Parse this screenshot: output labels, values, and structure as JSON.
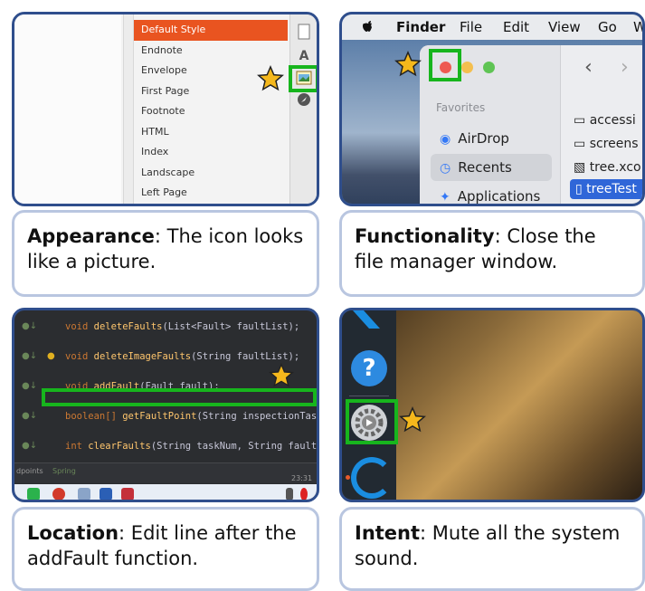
{
  "panel1": {
    "styles": [
      "Default Style",
      "Endnote",
      "Envelope",
      "First Page",
      "Footnote",
      "HTML",
      "Index",
      "Landscape",
      "Left Page"
    ],
    "caption_key": "Appearance",
    "caption_text": ": The icon looks like a picture."
  },
  "panel2": {
    "menu": {
      "apple": "",
      "finder": "Finder",
      "file": "File",
      "edit": "Edit",
      "view": "View",
      "go": "Go",
      "w": "W"
    },
    "favorites_label": "Favorites",
    "sidebar": [
      "AirDrop",
      "Recents",
      "Applications"
    ],
    "files": [
      "accessi",
      "screens",
      "tree.xco",
      "treeTest"
    ],
    "caption_key": "Functionality",
    "caption_text": ": Close the file manager window."
  },
  "panel3": {
    "lines": [
      {
        "kw": "void",
        "fn": "deleteFaults",
        "rest": "(List<Fault> faultList);"
      },
      {
        "kw": "void",
        "fn": "deleteImageFaults",
        "rest": "(String faultList);"
      },
      {
        "kw": "void",
        "fn": "addFault",
        "rest": "(Fault fault);"
      },
      {
        "kw": "boolean[]",
        "fn": "getFaultPoint",
        "rest": "(String inspectionTaskNu"
      },
      {
        "kw": "int",
        "fn": "clearFaults",
        "rest": "(String taskNum, String faultTyp"
      }
    ],
    "status_left": "dpoints",
    "status_mid": "Spring",
    "clock": "23:31",
    "caption_key": "Location",
    "caption_text": ": Edit line after the addFault function."
  },
  "panel4": {
    "help_glyph": "?",
    "caption_key": "Intent",
    "caption_text": ": Mute all the system sound."
  },
  "colors": {
    "highlight": "#17b51d",
    "star": "#f5b81c",
    "frame": "#2f4e8c",
    "caption_border": "#b9c6e0"
  }
}
